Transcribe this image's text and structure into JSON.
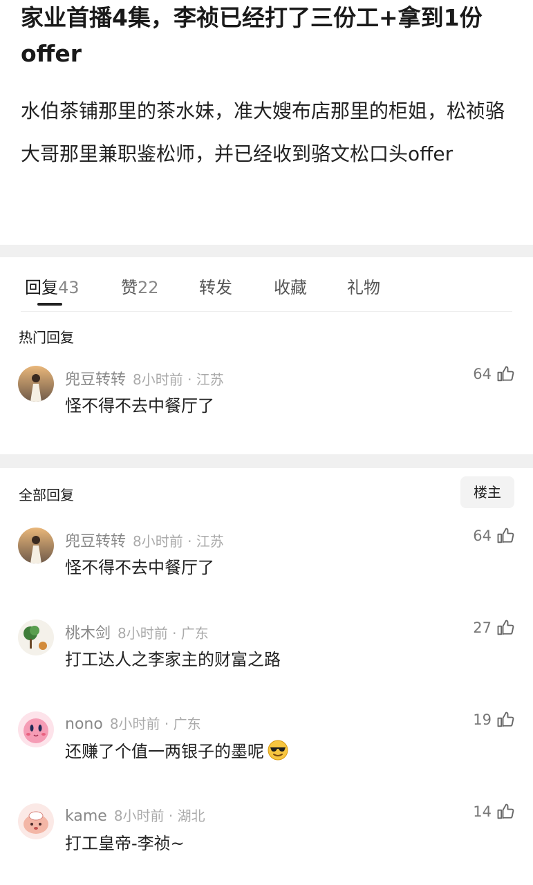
{
  "post": {
    "title": "家业首播4集，李祯已经打了三份工+拿到1份offer",
    "body": "水伯茶铺那里的茶水妹，准大嫂布店那里的柜姐，松祯骆大哥那里兼职鉴松师，并已经收到骆文松口头offer"
  },
  "tabs": [
    {
      "label": "回复",
      "count": "43"
    },
    {
      "label": "赞",
      "count": "22"
    },
    {
      "label": "转发",
      "count": ""
    },
    {
      "label": "收藏",
      "count": ""
    },
    {
      "label": "礼物",
      "count": ""
    }
  ],
  "hot": {
    "label": "热门回复",
    "comments": [
      {
        "name": "兜豆转转",
        "time": "8小时前 · 江苏",
        "text": "怪不得不去中餐厅了",
        "likes": "64"
      }
    ]
  },
  "all": {
    "label": "全部回复",
    "filter_label": "楼主",
    "comments": [
      {
        "name": "兜豆转转",
        "time": "8小时前 · 江苏",
        "text": "怪不得不去中餐厅了",
        "likes": "64"
      },
      {
        "name": "桃木剑",
        "time": "8小时前 · 广东",
        "text": "打工达人之李家主的财富之路",
        "likes": "27"
      },
      {
        "name": "nono",
        "time": "8小时前 · 广东",
        "text": "还赚了个值一两银子的墨呢",
        "likes": "19"
      },
      {
        "name": "kame",
        "time": "8小时前 · 湖北",
        "text": "打工皇帝-李祯~",
        "likes": "14"
      }
    ]
  },
  "icons": {
    "like": "thumbs-up-icon",
    "emoji": "sunglasses-emoji-icon"
  }
}
